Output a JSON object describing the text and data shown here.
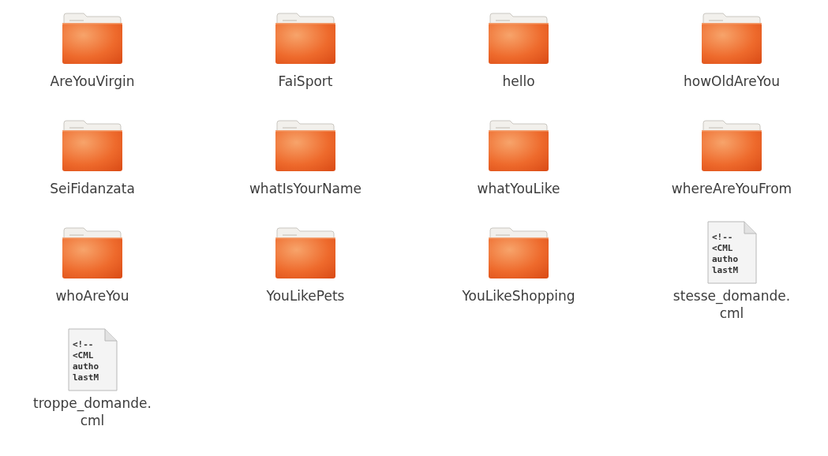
{
  "items": [
    {
      "kind": "folder",
      "name": "AreYouVirgin"
    },
    {
      "kind": "folder",
      "name": "FaiSport"
    },
    {
      "kind": "folder",
      "name": "hello"
    },
    {
      "kind": "folder",
      "name": "howOldAreYou"
    },
    {
      "kind": "folder",
      "name": "SeiFidanzata"
    },
    {
      "kind": "folder",
      "name": "whatIsYourName"
    },
    {
      "kind": "folder",
      "name": "whatYouLike"
    },
    {
      "kind": "folder",
      "name": "whereAreYouFrom"
    },
    {
      "kind": "folder",
      "name": "whoAreYou"
    },
    {
      "kind": "folder",
      "name": "YouLikePets"
    },
    {
      "kind": "folder",
      "name": "YouLikeShopping"
    },
    {
      "kind": "file",
      "name": "stesse_domande.cml",
      "preview": [
        "<!--",
        "<CML",
        "autho",
        "lastM"
      ]
    },
    {
      "kind": "file",
      "name": "troppe_domande.cml",
      "preview": [
        "<!--",
        "<CML",
        "autho",
        "lastM"
      ]
    }
  ]
}
